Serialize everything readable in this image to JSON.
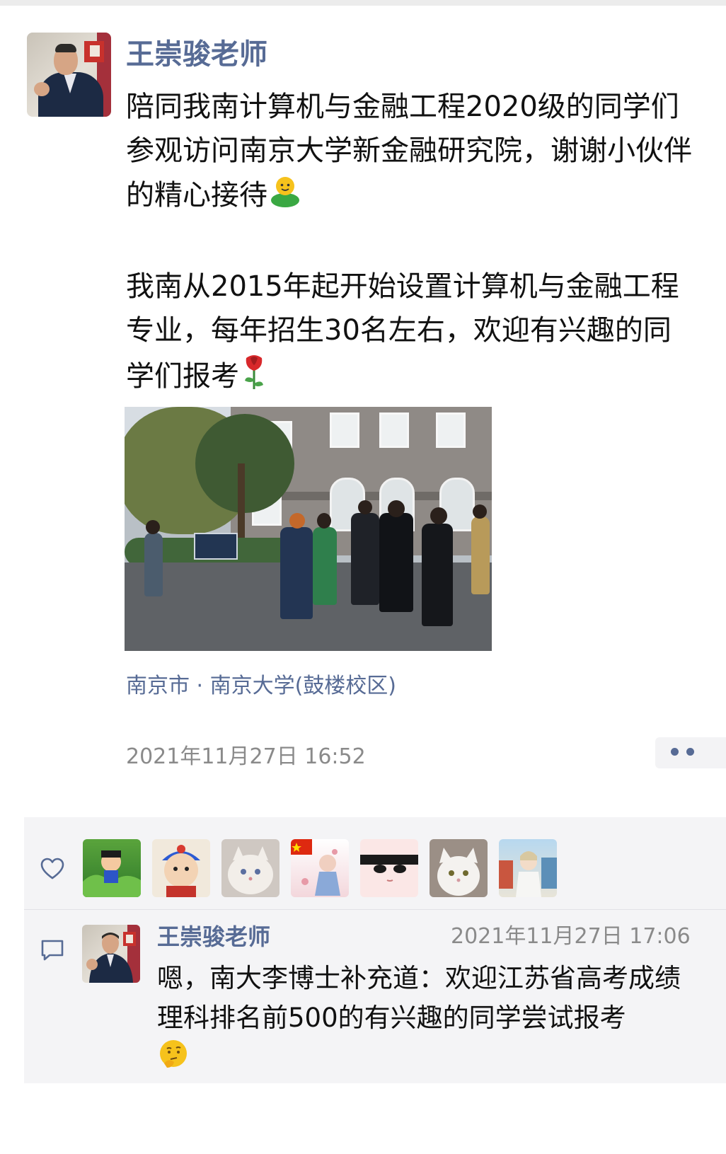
{
  "post": {
    "author": "王崇骏老师",
    "text_paragraph_1": "陪同我南计算机与金融工程2020级的同学们参观访问南京大学新金融研究院，谢谢小伙伴的精心接待",
    "text_paragraph_2": "我南从2015年起开始设置计算机与金融工程专业，每年招生30名左右，欢迎有兴趣的同学们报考",
    "emoji_1": "person-emoji",
    "emoji_2": "rose-emoji",
    "location": "南京市 · 南京大学(鼓楼校区)",
    "timestamp": "2021年11月27日 16:52",
    "more_dots": "••"
  },
  "likes": {
    "icon": "heart-outline-icon",
    "avatars": [
      "cartoon-boy-avatar",
      "cartoon-character-avatar",
      "white-cat-avatar",
      "flag-girl-avatar",
      "anime-face-avatar",
      "white-cat-photo-avatar",
      "anime-girl-avatar"
    ]
  },
  "comments": [
    {
      "author": "王崇骏老师",
      "time": "2021年11月27日 17:06",
      "text": "嗯，南大李博士补充道：欢迎江苏省高考成绩理科排名前500的有兴趣的同学尝试报考",
      "emoji": "thinking-face-emoji"
    }
  ],
  "colors": {
    "name_link": "#576b95",
    "body_text": "#111111",
    "meta_text": "#8a8a8a",
    "panel_bg": "#f4f4f6"
  }
}
